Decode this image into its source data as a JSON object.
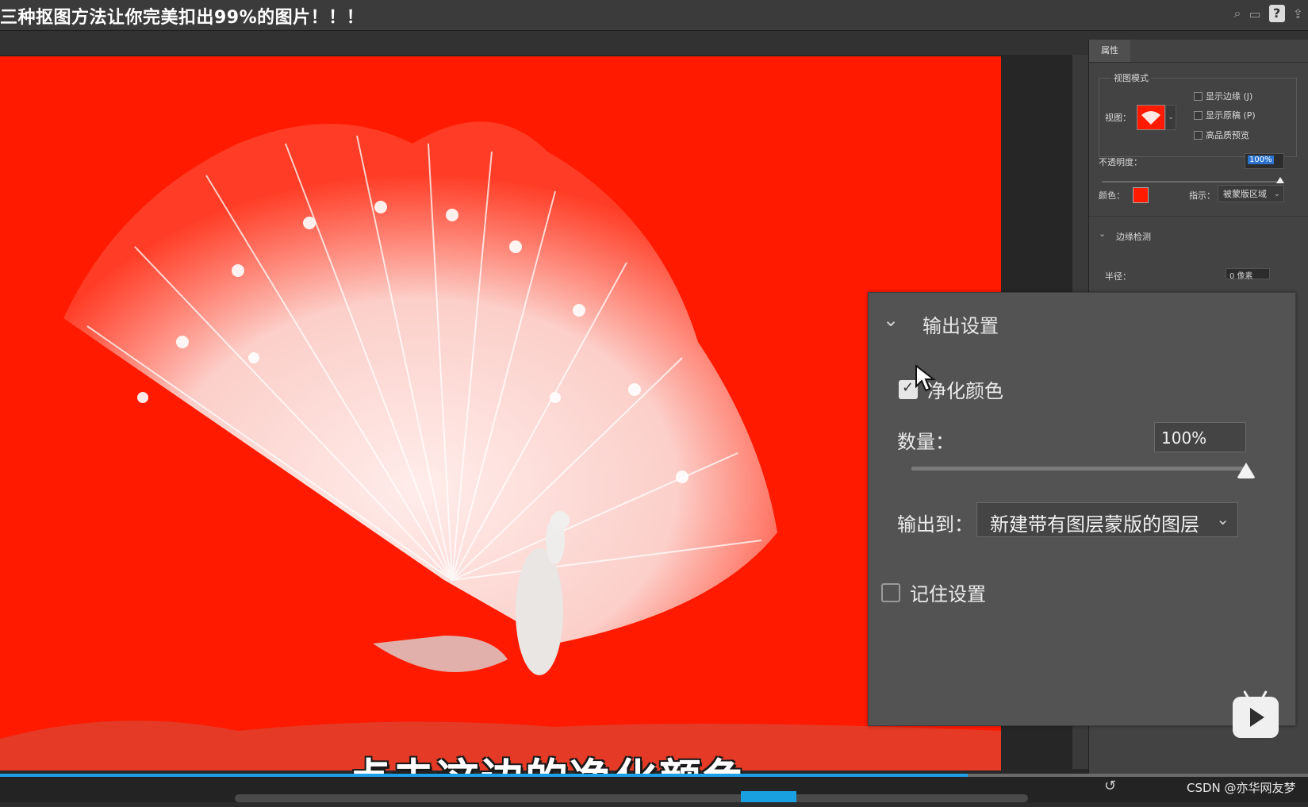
{
  "video_title": "三种抠图方法让你完美扣出99%的图片！！！",
  "properties_panel": {
    "tab_label": "属性",
    "view_mode_label": "视图模式",
    "view_label": "视图：",
    "show_edge": "显示边缘 (J)",
    "show_original": "显示原稿 (P)",
    "hq_preview": "高品质预览",
    "opacity_label": "不透明度：",
    "opacity_value": "100%",
    "color_label": "颜色：",
    "color_value": "#ff1a00",
    "indicate_label": "指示：",
    "indicate_value": "被蒙版区域",
    "edge_detect_label": "边缘检测",
    "radius_label": "半径：",
    "radius_value": "0 像素"
  },
  "output_settings": {
    "title": "输出设置",
    "decontaminate_label": "净化颜色",
    "decontaminate_checked": true,
    "amount_label": "数量：",
    "amount_value": "100%",
    "amount_level": 1.0,
    "output_to_label": "输出到：",
    "output_to_value": "新建带有图层蒙版的图层",
    "remember_label": "记住设置",
    "remember_checked": false
  },
  "subtitle": "点击这边的净化颜色",
  "watermark": "CSDN @亦华网友梦",
  "canvas_bg_color": "#ff1a00",
  "video_progress": 0.74,
  "icons": [
    "search-icon",
    "help-icon",
    "share-icon",
    "chevron-down-icon",
    "cursor-icon",
    "play-icon",
    "undo-icon"
  ]
}
